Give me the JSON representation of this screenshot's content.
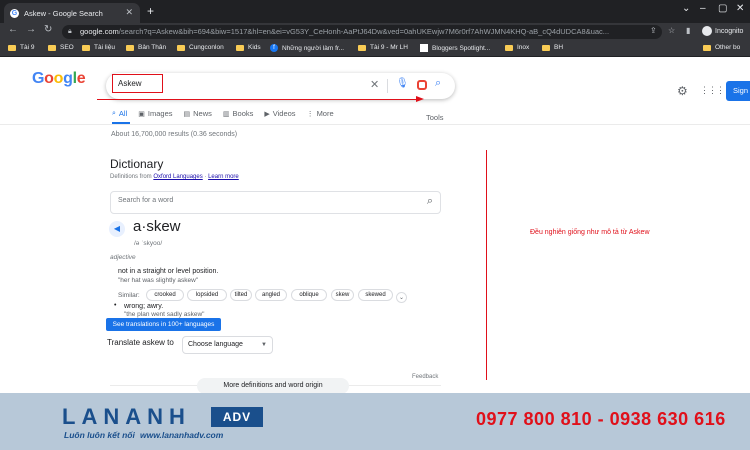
{
  "browser": {
    "tab_title": "Askew - Google Search",
    "url_host": "google.com",
    "url_rest": "/search?q=Askew&bih=694&biw=1517&hl=en&ei=vG53Y_CeHonh-AaPtJ64Dw&ved=0ahUKEwjw7M6r0rf7AhWJMN4KHQ-aB_cQ4dUDCA8&uac...",
    "profile_label": "Incognito",
    "bookmarks": [
      "Tài 9",
      "SEO",
      "Tài liệu",
      "Bản Thân",
      "Cungconlon",
      "Kids",
      "Những người làm fr...",
      "Tài 9 - Mr LH",
      "Bloggers Spotlight...",
      "Inox",
      "BH"
    ],
    "other_bookmarks": "Other bo"
  },
  "google": {
    "logo_letters": [
      "G",
      "o",
      "o",
      "g",
      "l",
      "e"
    ],
    "query": "Askew",
    "sign_in": "Sign i",
    "tabs": [
      {
        "label": "All",
        "icon": "⌕",
        "active": true
      },
      {
        "label": "Images",
        "icon": "▣",
        "active": false
      },
      {
        "label": "News",
        "icon": "▤",
        "active": false
      },
      {
        "label": "Books",
        "icon": "▥",
        "active": false
      },
      {
        "label": "Videos",
        "icon": "▶",
        "active": false
      },
      {
        "label": "More",
        "icon": "⋮",
        "active": false
      }
    ],
    "tools": "Tools",
    "stats": "About 16,700,000 results (0.36 seconds)"
  },
  "dictionary": {
    "title": "Dictionary",
    "source_prefix": "Definitions from ",
    "source_link": "Oxford Languages",
    "learn_more": "Learn more",
    "search_placeholder": "Search for a word",
    "word": "a·skew",
    "phonetic": "/ə ˈskyoo/",
    "part_of_speech": "adjective",
    "definition_1": "not in a straight or level position.",
    "example_1": "\"her hat was slightly askew\"",
    "similar_label": "Similar:",
    "similar": [
      "crooked",
      "lopsided",
      "tilted",
      "angled",
      "oblique",
      "skew",
      "skewed"
    ],
    "definition_2": "wrong; awry.",
    "example_2": "\"the plan went sadly askew\"",
    "translations_button": "See translations in 100+ languages",
    "translate_label": "Translate askew to",
    "choose_language": "Choose language",
    "feedback": "Feedback",
    "more_definitions": "More definitions and word origin"
  },
  "annotation": {
    "note": "Đều nghiên giống như mô tả từ Askew",
    "color": "#e0101a"
  },
  "banner": {
    "brand": "LANANH",
    "adv": "ADV",
    "slogan": "Luôn luôn kết nối",
    "website": "www.lananhadv.com",
    "phone": "0977 800 810 - 0938 630 616"
  }
}
